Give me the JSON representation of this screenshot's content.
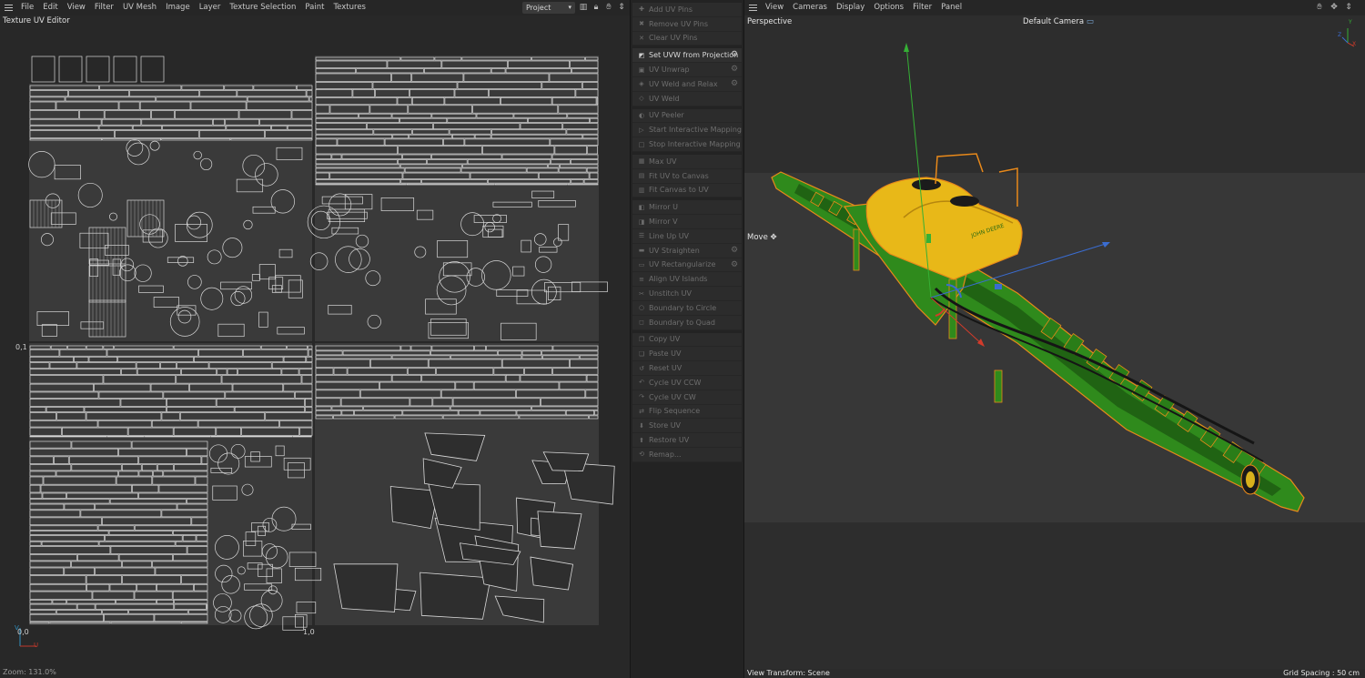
{
  "uv_editor": {
    "menu": [
      "File",
      "Edit",
      "View",
      "Filter",
      "UV Mesh",
      "Image",
      "Layer",
      "Texture Selection",
      "Paint",
      "Textures"
    ],
    "panel_title": "Texture UV Editor",
    "project_select": "Project",
    "toolbar_icons": [
      "histogram-icon",
      "lock-icon",
      "pan-hand-icon",
      "arrows-icon"
    ],
    "axis": {
      "top_left": "0,1",
      "origin": "0,0",
      "right": "1,0",
      "v_axis": "V",
      "u_axis": "U"
    },
    "zoom": "Zoom: 131.0%"
  },
  "uv_commands": {
    "groups": [
      [
        {
          "label": "Add UV Pins",
          "icon": "pin-add-icon",
          "active": false,
          "gear": false
        },
        {
          "label": "Remove UV Pins",
          "icon": "pin-remove-icon",
          "active": false,
          "gear": false
        },
        {
          "label": "Clear UV Pins",
          "icon": "pin-clear-icon",
          "active": false,
          "gear": false
        }
      ],
      [
        {
          "label": "Set UVW from Projection",
          "icon": "projection-icon",
          "active": true,
          "gear": true
        },
        {
          "label": "UV Unwrap",
          "icon": "unwrap-icon",
          "active": false,
          "gear": true
        },
        {
          "label": "UV Weld and Relax",
          "icon": "weld-relax-icon",
          "active": false,
          "gear": true
        },
        {
          "label": "UV Weld",
          "icon": "weld-icon",
          "active": false,
          "gear": false
        }
      ],
      [
        {
          "label": "UV Peeler",
          "icon": "peeler-icon",
          "active": false,
          "gear": false
        },
        {
          "label": "Start Interactive Mapping",
          "icon": "play-icon",
          "active": false,
          "gear": false
        },
        {
          "label": "Stop Interactive Mapping",
          "icon": "stop-icon",
          "active": false,
          "gear": false
        }
      ],
      [
        {
          "label": "Max UV",
          "icon": "max-uv-icon",
          "active": false,
          "gear": false
        },
        {
          "label": "Fit UV to Canvas",
          "icon": "fit-uv-icon",
          "active": false,
          "gear": false
        },
        {
          "label": "Fit Canvas to UV",
          "icon": "fit-canvas-icon",
          "active": false,
          "gear": false
        }
      ],
      [
        {
          "label": "Mirror U",
          "icon": "mirror-u-icon",
          "active": false,
          "gear": false
        },
        {
          "label": "Mirror V",
          "icon": "mirror-v-icon",
          "active": false,
          "gear": false
        },
        {
          "label": "Line Up UV",
          "icon": "line-up-icon",
          "active": false,
          "gear": false
        },
        {
          "label": "UV Straighten",
          "icon": "straighten-icon",
          "active": false,
          "gear": true
        },
        {
          "label": "UV Rectangularize",
          "icon": "rectangularize-icon",
          "active": false,
          "gear": true
        },
        {
          "label": "Align UV Islands",
          "icon": "align-icon",
          "active": false,
          "gear": false
        },
        {
          "label": "Unstitch UV",
          "icon": "unstitch-icon",
          "active": false,
          "gear": false
        },
        {
          "label": "Boundary to Circle",
          "icon": "circle-icon",
          "active": false,
          "gear": false
        },
        {
          "label": "Boundary to Quad",
          "icon": "quad-icon",
          "active": false,
          "gear": false
        }
      ],
      [
        {
          "label": "Copy UV",
          "icon": "copy-icon",
          "active": false,
          "gear": false
        },
        {
          "label": "Paste UV",
          "icon": "paste-icon",
          "active": false,
          "gear": false
        },
        {
          "label": "Reset UV",
          "icon": "reset-icon",
          "active": false,
          "gear": false
        },
        {
          "label": "Cycle UV CCW",
          "icon": "cycle-ccw-icon",
          "active": false,
          "gear": false
        },
        {
          "label": "Cycle UV CW",
          "icon": "cycle-cw-icon",
          "active": false,
          "gear": false
        },
        {
          "label": "Flip Sequence",
          "icon": "flip-icon",
          "active": false,
          "gear": false
        },
        {
          "label": "Store UV",
          "icon": "store-icon",
          "active": false,
          "gear": false
        },
        {
          "label": "Restore UV",
          "icon": "restore-icon",
          "active": false,
          "gear": false
        },
        {
          "label": "Remap...",
          "icon": "remap-icon",
          "active": false,
          "gear": false
        }
      ]
    ]
  },
  "viewport": {
    "menu": [
      "View",
      "Cameras",
      "Display",
      "Options",
      "Filter",
      "Panel"
    ],
    "title": "Perspective",
    "camera": "Default Camera",
    "tool": "Move",
    "view_transform": "View Transform: Scene",
    "grid_spacing": "Grid Spacing : 50 cm",
    "axis_labels": {
      "y": "Y",
      "z": "Z",
      "x": "X"
    },
    "model_brand": "JOHN DEERE",
    "colors": {
      "body": "#2f8a1c",
      "tank": "#e8b818",
      "outline": "#e8891a",
      "axis_x": "#d23b2b",
      "axis_y": "#35b035",
      "axis_z": "#3a6cd0"
    }
  }
}
